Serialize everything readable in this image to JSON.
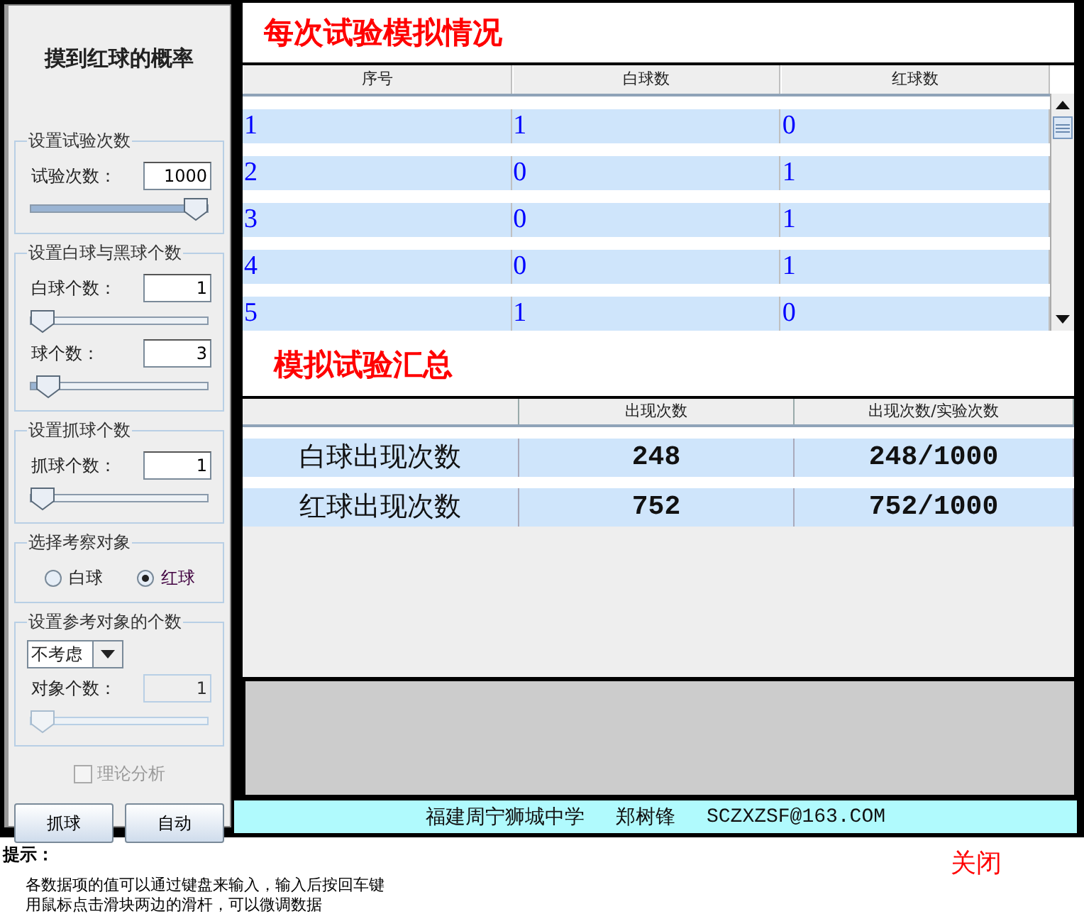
{
  "sidebar": {
    "title": "摸到红球的概率",
    "groups": [
      {
        "legend": "设置试验次数",
        "items": [
          {
            "kind": "field",
            "label": "试验次数：",
            "value": "1000",
            "level": 1,
            "disabled": false
          }
        ]
      },
      {
        "legend": "设置白球与黑球个数",
        "items": [
          {
            "kind": "field",
            "label": "白球个数：",
            "value": "1",
            "level": 0,
            "disabled": false
          },
          {
            "kind": "field",
            "label": "球个数：",
            "value": "3",
            "level": 0.04,
            "disabled": false
          }
        ]
      },
      {
        "legend": "设置抓球个数",
        "items": [
          {
            "kind": "field",
            "label": "抓球个数：",
            "value": "1",
            "level": 0,
            "disabled": false
          }
        ]
      },
      {
        "legend": "选择考察对象",
        "items": [
          {
            "kind": "radios",
            "options": [
              {
                "label": "白球",
                "selected": false
              },
              {
                "label": "红球",
                "selected": true
              }
            ]
          }
        ]
      },
      {
        "legend": "设置参考对象的个数",
        "items": [
          {
            "kind": "dropdown",
            "value": "不考虑"
          },
          {
            "kind": "field",
            "label": "对象个数：",
            "value": "1",
            "level": 0,
            "disabled": true
          }
        ]
      }
    ],
    "analysis": {
      "label": "理论分析",
      "checked": false,
      "disabled": true
    },
    "buttons": [
      "抓球",
      "自动"
    ]
  },
  "trials": {
    "title": "每次试验模拟情况",
    "columns": [
      "序号",
      "白球数",
      "红球数"
    ],
    "rows": [
      [
        "1",
        "1",
        "0"
      ],
      [
        "2",
        "0",
        "1"
      ],
      [
        "3",
        "0",
        "1"
      ],
      [
        "4",
        "0",
        "1"
      ],
      [
        "5",
        "1",
        "0"
      ]
    ]
  },
  "summary": {
    "title": "模拟试验汇总",
    "columns": [
      "出现次数",
      "出现次数/实验次数"
    ],
    "rows": [
      {
        "label": "白球出现次数",
        "count": "248",
        "ratio": "248/1000"
      },
      {
        "label": "红球出现次数",
        "count": "752",
        "ratio": "752/1000"
      }
    ]
  },
  "footer": [
    "福建周宁狮城中学",
    "郑树锋",
    "SCZXZSF@163.COM"
  ],
  "hint": {
    "title": "提示：",
    "lines": [
      "各数据项的值可以通过键盘来输入，输入后按回车键",
      "用鼠标点击滑块两边的滑杆，可以微调数据"
    ]
  },
  "close_button": "关闭"
}
